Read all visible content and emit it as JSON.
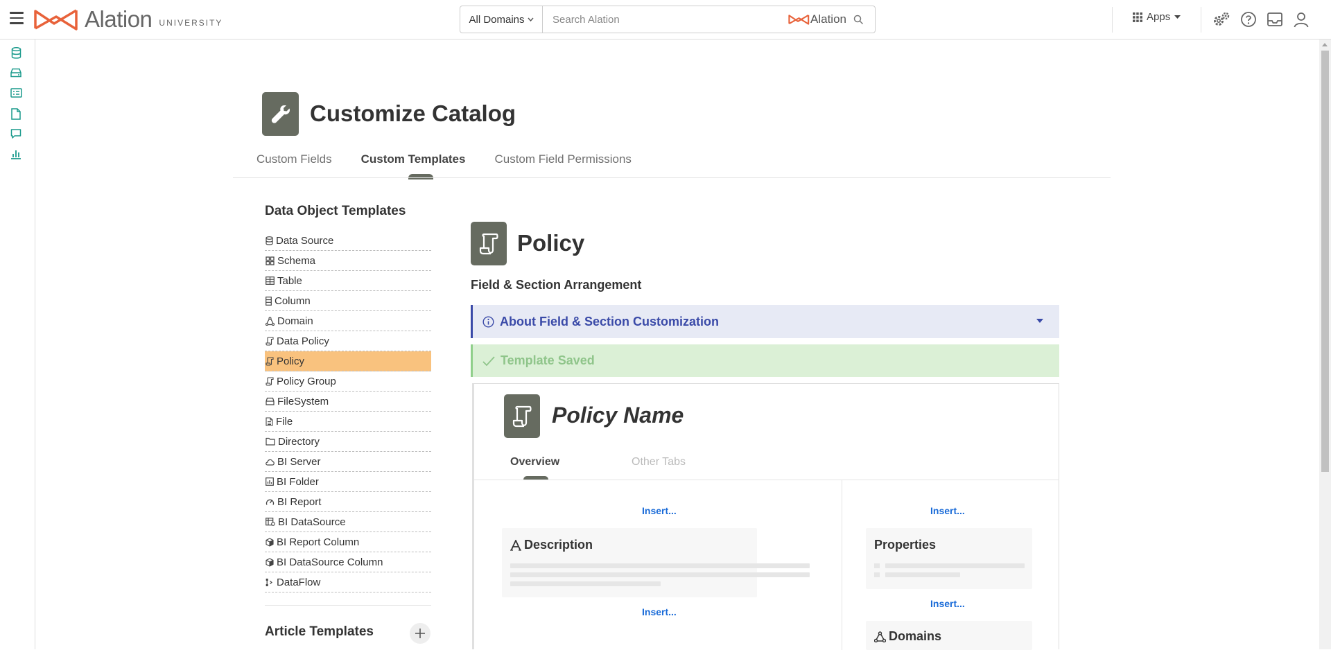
{
  "app": {
    "brand_name": "Alation",
    "brand_sub": "UNIVERSITY"
  },
  "search": {
    "domain_label": "All Domains",
    "placeholder": "Search Alation",
    "logo_text": "Alation"
  },
  "apps_label": "Apps",
  "page": {
    "title": "Customize Catalog",
    "tabs": [
      {
        "label": "Custom Fields"
      },
      {
        "label": "Custom Templates"
      },
      {
        "label": "Custom Field Permissions"
      }
    ]
  },
  "sidebar": {
    "heading": "Data Object Templates",
    "items": [
      {
        "label": "Data Source",
        "icon": "database-icon"
      },
      {
        "label": "Schema",
        "icon": "schema-icon"
      },
      {
        "label": "Table",
        "icon": "table-icon"
      },
      {
        "label": "Column",
        "icon": "column-icon"
      },
      {
        "label": "Domain",
        "icon": "domain-icon"
      },
      {
        "label": "Data Policy",
        "icon": "policy-icon"
      },
      {
        "label": "Policy",
        "icon": "policy-icon"
      },
      {
        "label": "Policy Group",
        "icon": "policy-icon"
      },
      {
        "label": "FileSystem",
        "icon": "filesystem-icon"
      },
      {
        "label": "File",
        "icon": "file-icon"
      },
      {
        "label": "Directory",
        "icon": "folder-icon"
      },
      {
        "label": "BI Server",
        "icon": "cloud-icon"
      },
      {
        "label": "BI Folder",
        "icon": "bi-folder-icon"
      },
      {
        "label": "BI Report",
        "icon": "gauge-icon"
      },
      {
        "label": "BI DataSource",
        "icon": "bi-datasource-icon"
      },
      {
        "label": "BI Report Column",
        "icon": "cube-icon"
      },
      {
        "label": "BI DataSource Column",
        "icon": "cube-icon"
      },
      {
        "label": "DataFlow",
        "icon": "dataflow-icon"
      }
    ],
    "selected_label": "Policy",
    "article_heading": "Article Templates"
  },
  "main": {
    "object_title": "Policy",
    "arrange_heading": "Field & Section Arrangement",
    "about_text": "About Field & Section Customization",
    "saved_text": "Template Saved",
    "preview": {
      "title": "Policy Name",
      "tab_overview": "Overview",
      "tab_other": "Other Tabs",
      "insert_label": "Insert...",
      "description_title": "Description",
      "properties_title": "Properties",
      "domains_title": "Domains"
    }
  },
  "colors": {
    "brand_orange": "#e8623a",
    "rail_teal": "#1a9a8c",
    "selected_item": "#f9c27e",
    "info_blue": "#3a4aa8",
    "success_green": "#8fc58a"
  }
}
